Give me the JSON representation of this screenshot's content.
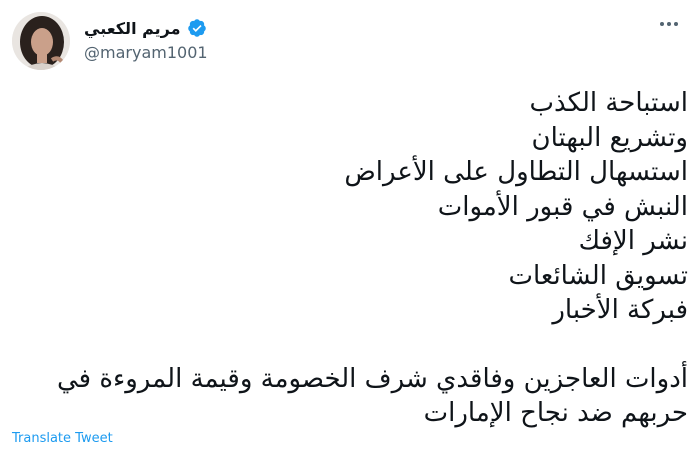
{
  "tweet": {
    "author_name": "مريم الكعبي",
    "author_handle": "@maryam1001",
    "verified": true,
    "lines_group1": [
      "استباحة الكذب",
      "وتشريع البهتان",
      "استسهال التطاول على الأعراض",
      "النبش في قبور الأموات",
      "نشر الإفك",
      "تسويق الشائعات",
      "فبركة الأخبار"
    ],
    "lines_group2": [
      "أدوات العاجزين وفاقدي شرف الخصومة وقيمة المروءة في",
      "حربهم ضد نجاح الإمارات"
    ],
    "translate_label": "Translate Tweet"
  },
  "colors": {
    "accent": "#1d9bf0",
    "text": "#0f1419",
    "muted": "#536471"
  },
  "icons": {
    "verified": "verified-badge-icon",
    "more": "more-horizontal-icon"
  }
}
